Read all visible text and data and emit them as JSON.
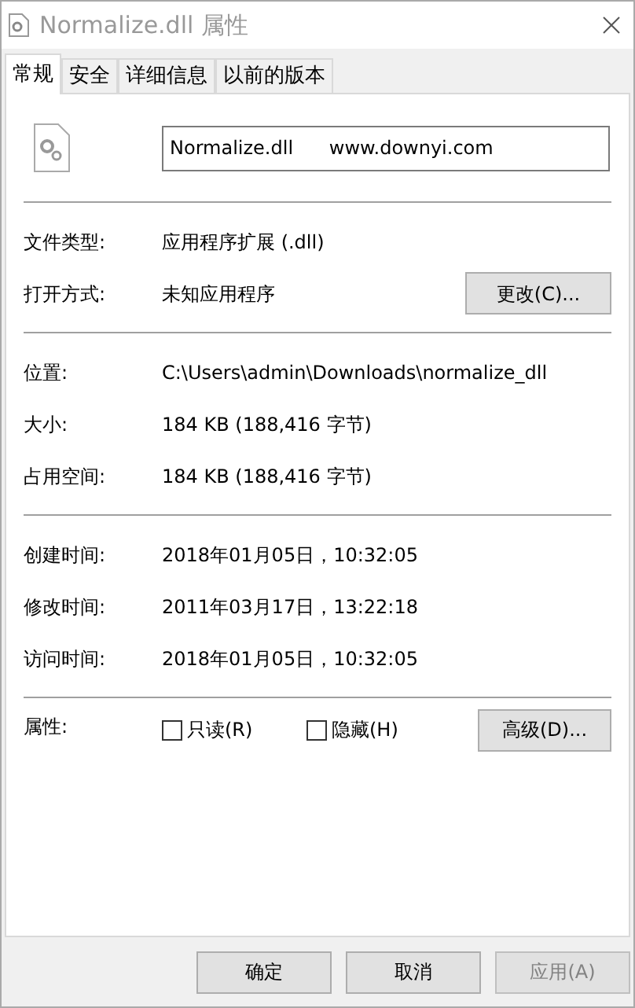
{
  "window": {
    "title": "Normalize.dll 属性"
  },
  "tabs": [
    {
      "label": "常规",
      "selected": true
    },
    {
      "label": "安全",
      "selected": false
    },
    {
      "label": "详细信息",
      "selected": false
    },
    {
      "label": "以前的版本",
      "selected": false
    }
  ],
  "name_field": {
    "value": "Normalize.dll      www.downyi.com"
  },
  "type_rows": [
    {
      "label": "文件类型:",
      "value": "应用程序扩展 (.dll)"
    },
    {
      "label": "打开方式:",
      "value": "未知应用程序",
      "button": "更改(C)..."
    }
  ],
  "location_rows": [
    {
      "label": "位置:",
      "value": "C:\\Users\\admin\\Downloads\\normalize_dll"
    },
    {
      "label": "大小:",
      "value": "184 KB (188,416 字节)"
    },
    {
      "label": "占用空间:",
      "value": "184 KB (188,416 字节)"
    }
  ],
  "time_rows": [
    {
      "label": "创建时间:",
      "value": "2018年01月05日，10:32:05"
    },
    {
      "label": "修改时间:",
      "value": "2011年03月17日，13:22:18"
    },
    {
      "label": "访问时间:",
      "value": "2018年01月05日，10:32:05"
    }
  ],
  "attributes": {
    "label": "属性:",
    "checkboxes": [
      {
        "label": "只读(R)",
        "checked": false
      },
      {
        "label": "隐藏(H)",
        "checked": false
      }
    ],
    "button": "高级(D)..."
  },
  "buttons": [
    {
      "label": "确定",
      "disabled": false
    },
    {
      "label": "取消",
      "disabled": false
    },
    {
      "label": "应用(A)",
      "disabled": true
    }
  ]
}
